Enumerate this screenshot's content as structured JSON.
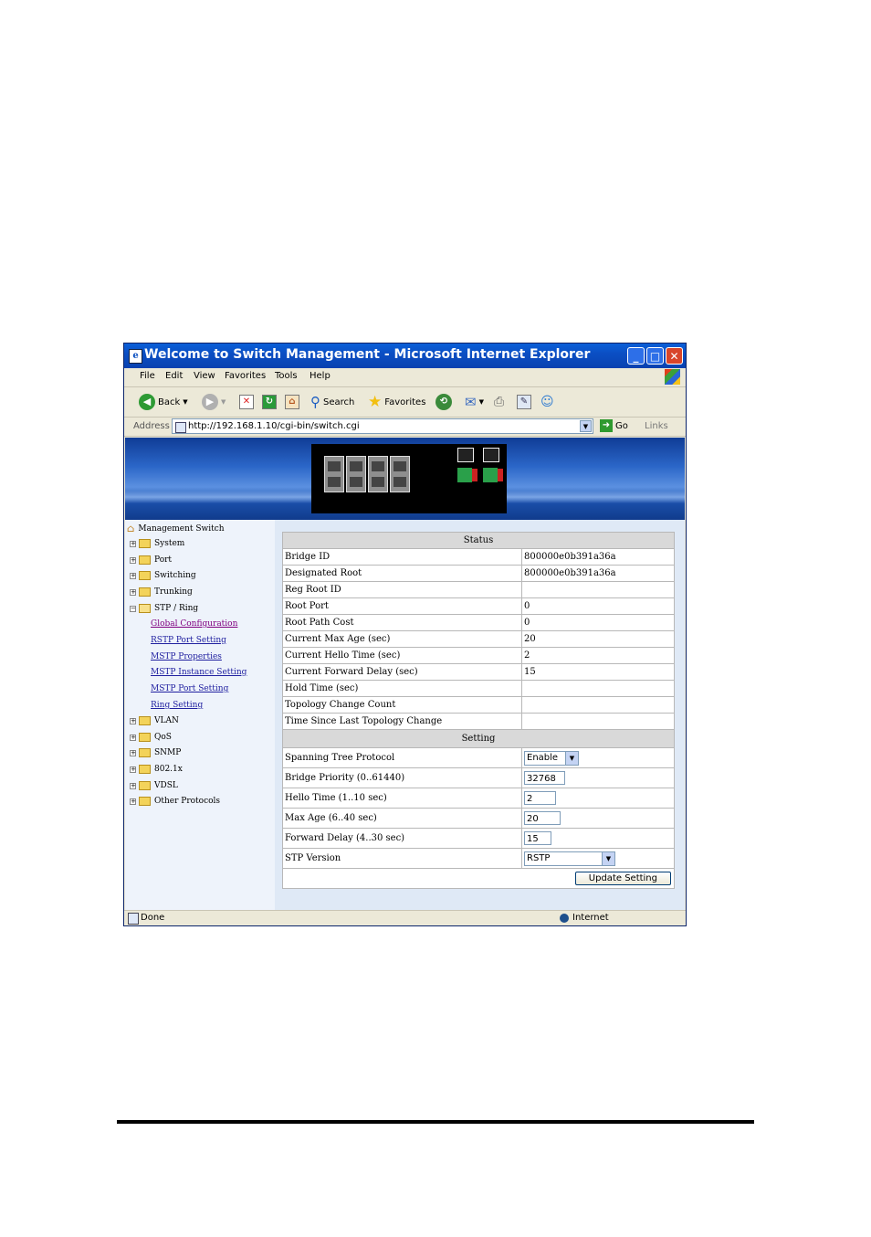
{
  "window": {
    "title": "Welcome to Switch Management - Microsoft Internet Explorer",
    "min": "_",
    "max": "□",
    "close": "✕"
  },
  "menu": [
    "File",
    "Edit",
    "View",
    "Favorites",
    "Tools",
    "Help"
  ],
  "toolbar": {
    "back": "Back",
    "search": "Search",
    "favorites": "Favorites"
  },
  "address": {
    "label": "Address",
    "url": "http://192.168.1.10/cgi-bin/switch.cgi",
    "go": "Go",
    "links": "Links"
  },
  "sidebar": {
    "root": "Management Switch",
    "items": [
      "System",
      "Port",
      "Switching",
      "Trunking",
      "STP / Ring"
    ],
    "stp_children": [
      "Global Configuration",
      "RSTP Port Setting",
      "MSTP Properties",
      "MSTP Instance Setting",
      "MSTP Port Setting",
      "Ring Setting"
    ],
    "items_after": [
      "VLAN",
      "QoS",
      "SNMP",
      "802.1x",
      "VDSL",
      "Other Protocols"
    ]
  },
  "status_table": {
    "header": "Status",
    "rows": [
      {
        "label": "Bridge ID",
        "value": "800000e0b391a36a"
      },
      {
        "label": "Designated Root",
        "value": "800000e0b391a36a"
      },
      {
        "label": "Reg Root ID",
        "value": ""
      },
      {
        "label": "Root Port",
        "value": "0"
      },
      {
        "label": "Root Path Cost",
        "value": "0"
      },
      {
        "label": "Current Max Age (sec)",
        "value": "20"
      },
      {
        "label": "Current Hello Time (sec)",
        "value": "2"
      },
      {
        "label": "Current Forward Delay (sec)",
        "value": "15"
      },
      {
        "label": "Hold Time (sec)",
        "value": ""
      },
      {
        "label": "Topology Change Count",
        "value": ""
      },
      {
        "label": "Time Since Last Topology Change",
        "value": ""
      }
    ]
  },
  "setting_table": {
    "header": "Setting",
    "spanning_tree": {
      "label": "Spanning Tree Protocol",
      "value": "Enable"
    },
    "bridge_priority": {
      "label": "Bridge Priority (0..61440)",
      "value": "32768"
    },
    "hello_time": {
      "label": "Hello Time (1..10 sec)",
      "value": "2"
    },
    "max_age": {
      "label": "Max Age (6..40 sec)",
      "value": "20"
    },
    "forward_delay": {
      "label": "Forward Delay (4..30 sec)",
      "value": "15"
    },
    "stp_version": {
      "label": "STP Version",
      "value": "RSTP"
    },
    "update_button": "Update Setting"
  },
  "statusbar": {
    "left": "Done",
    "zone": "Internet"
  }
}
